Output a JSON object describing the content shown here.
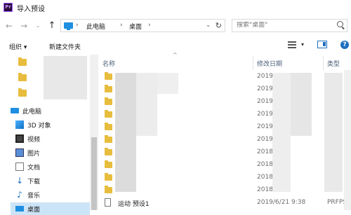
{
  "window": {
    "app_icon_text": "Pr",
    "title": "导入预设"
  },
  "address": {
    "separator": "›",
    "crumbs": [
      "此电脑",
      "桌面"
    ],
    "search_placeholder": "搜索\"桌面\""
  },
  "toolbar": {
    "organize_label": "组织 ▾",
    "new_folder_label": "新建文件夹"
  },
  "nav": {
    "this_pc": "此电脑",
    "items": [
      "3D 对象",
      "视频",
      "图片",
      "文档",
      "下载",
      "音乐",
      "桌面"
    ]
  },
  "columns": {
    "name": "名称",
    "date": "修改日期",
    "type": "类型"
  },
  "files": [
    {
      "date": "2019"
    },
    {
      "date": "2019"
    },
    {
      "date": "2019"
    },
    {
      "date": "2019"
    },
    {
      "date": "2019"
    },
    {
      "date": "2019"
    },
    {
      "date": "2018"
    },
    {
      "date": "2018"
    },
    {
      "date": "2018"
    },
    {
      "date": "2018"
    },
    {
      "name": "运动 预设1",
      "date": "2019/6/21 9:38",
      "type": "PRFPS"
    }
  ]
}
